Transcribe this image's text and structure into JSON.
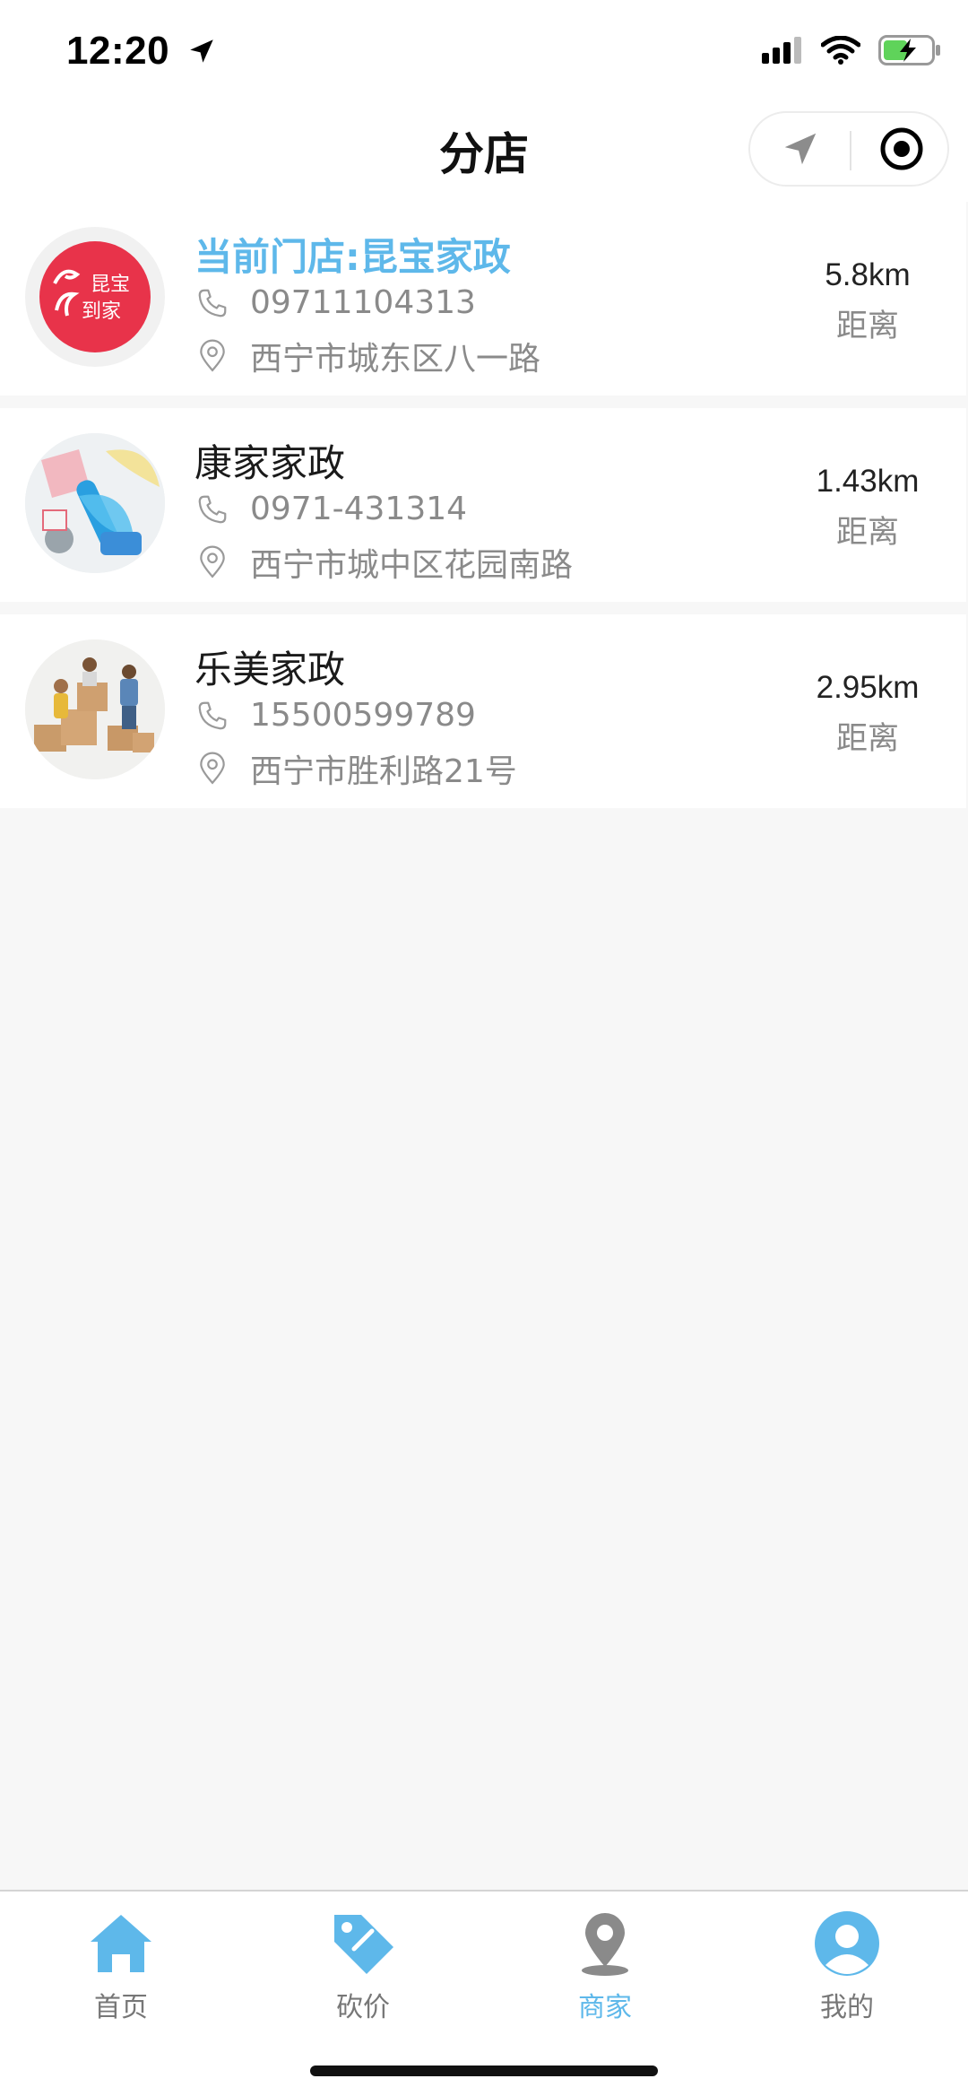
{
  "status_bar": {
    "time": "12:20"
  },
  "nav": {
    "title": "分店"
  },
  "stores": [
    {
      "name": "当前门店:昆宝家政",
      "phone": "09711104313",
      "address": "西宁市城东区八一路",
      "distance": "5.8km",
      "distance_label": "距离",
      "logo_text_top": "昆宝",
      "logo_text_bottom": "到家"
    },
    {
      "name": "康家家政",
      "phone": "0971-431314",
      "address": "西宁市城中区花园南路",
      "distance": "1.43km",
      "distance_label": "距离"
    },
    {
      "name": "乐美家政",
      "phone": "15500599789",
      "address": "西宁市胜利路21号",
      "distance": "2.95km",
      "distance_label": "距离"
    }
  ],
  "tabbar": {
    "items": [
      {
        "label": "首页",
        "icon": "home-icon"
      },
      {
        "label": "砍价",
        "icon": "price-tag-icon"
      },
      {
        "label": "商家",
        "icon": "map-pin-icon"
      },
      {
        "label": "我的",
        "icon": "user-icon"
      }
    ],
    "active_index": 2
  },
  "colors": {
    "accent": "#5eb8ea",
    "background": "#f7f7f7"
  }
}
